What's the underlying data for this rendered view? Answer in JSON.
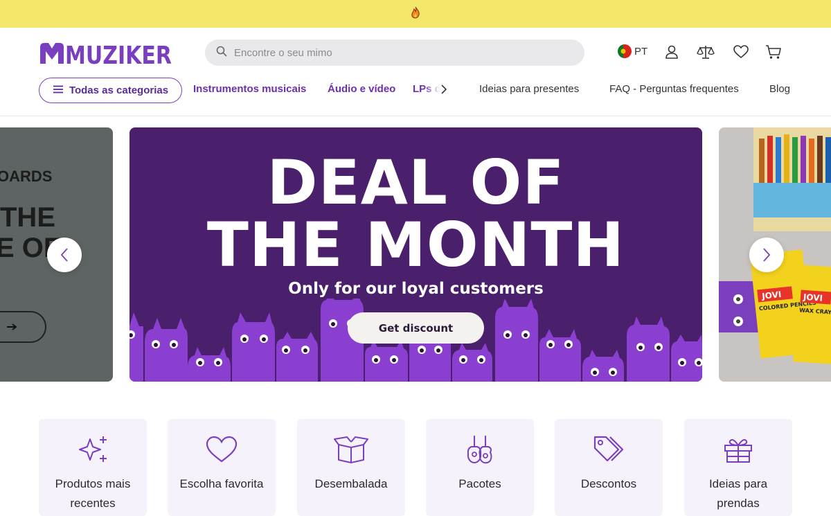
{
  "promo_bar": {
    "icon": "fire-icon"
  },
  "header": {
    "logo_text": "MUZIKER",
    "search": {
      "placeholder": "Encontre o seu mimo",
      "value": ""
    },
    "language": {
      "code": "PT",
      "flag": "portugal-flag-icon"
    },
    "icons": [
      "user-icon",
      "compare-scale-icon",
      "heart-icon",
      "cart-icon"
    ]
  },
  "nav": {
    "all_categories": "Todas as categorias",
    "main_items": [
      "Instrumentos musicais",
      "Áudio e vídeo",
      "LPs de vinil"
    ],
    "secondary_items": [
      "Ideias para presentes",
      "FAQ - Perguntas frequentes",
      "Blog"
    ]
  },
  "hero": {
    "left_slide": {
      "line1": "OARDS",
      "line2": "THE",
      "line3": "E OF"
    },
    "main_slide": {
      "title_line1": "DEAL OF",
      "title_line2": "THE MONTH",
      "subtitle": "Only for our loyal customers",
      "button": "Get discount"
    },
    "right_slide": {
      "product1": "JOVI",
      "product1_label": "COLORED PENCILS",
      "product2": "JOVI",
      "product2_label": "WAX CRAYONS"
    }
  },
  "categories": [
    {
      "label": "Produtos mais recentes",
      "icon": "sparkles-icon"
    },
    {
      "label": "Escolha favorita",
      "icon": "heart-icon"
    },
    {
      "label": "Desembalada",
      "icon": "open-box-icon"
    },
    {
      "label": "Pacotes",
      "icon": "guitars-icon"
    },
    {
      "label": "Descontos",
      "icon": "price-tags-icon"
    },
    {
      "label": "Ideias para prendas",
      "icon": "gift-icon"
    }
  ],
  "colors": {
    "brand": "#7a3fbf",
    "promo_bar": "#f2e76b",
    "hero_bg": "#4a1f6b",
    "card_bg": "#f6f2fb"
  }
}
